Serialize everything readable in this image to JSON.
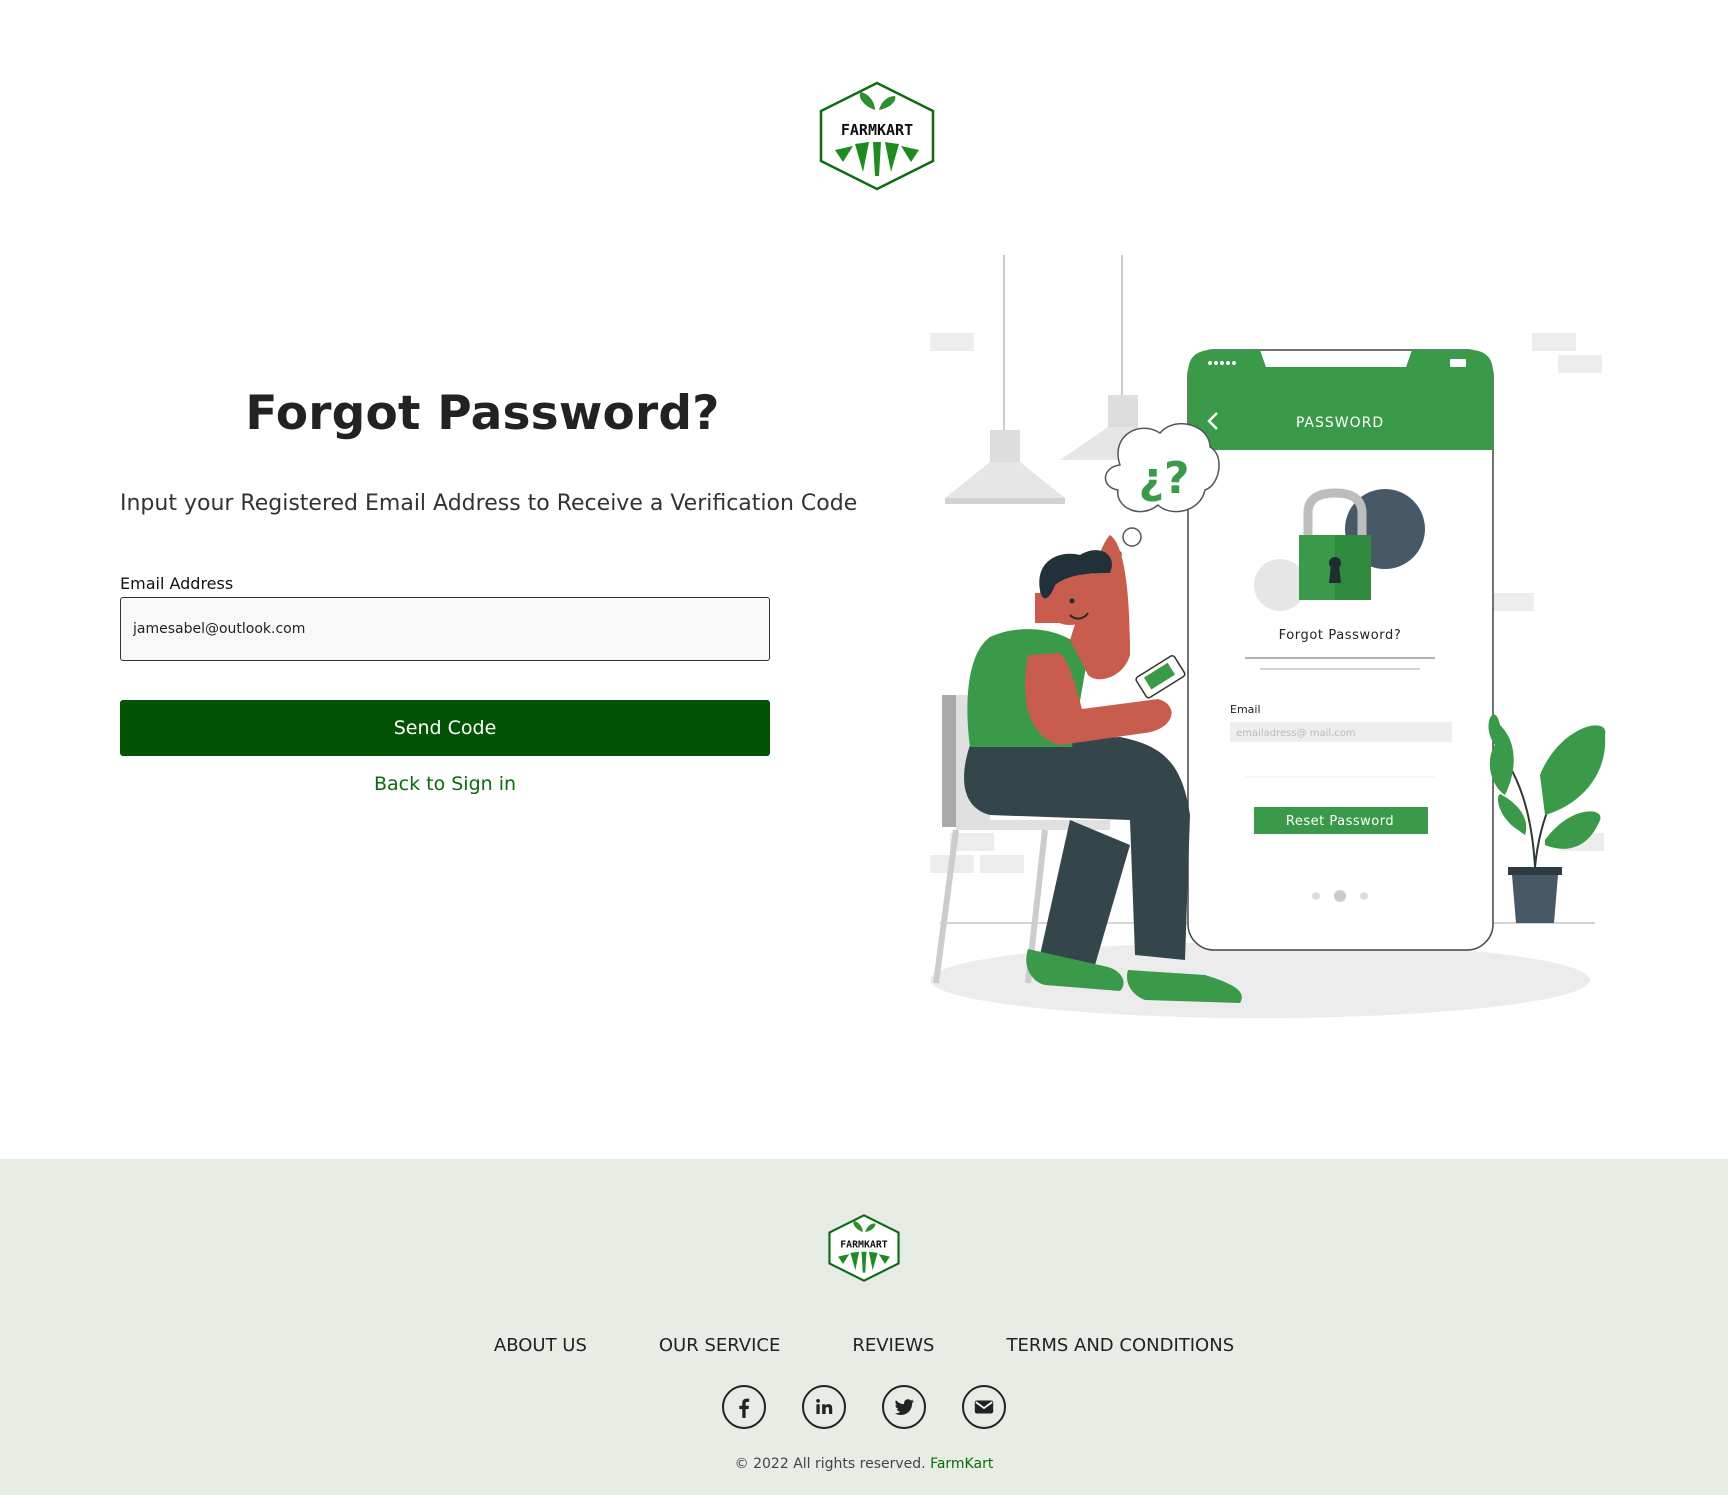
{
  "brand": {
    "logo_text": "FARMKART",
    "colors": {
      "primary": "#035304",
      "accent": "#3a9a4a",
      "footer_bg": "#e7ede4"
    }
  },
  "main": {
    "title": "Forgot Password?",
    "subtitle": "Input your Registered Email Address to Receive a Verification Code",
    "email_label": "Email Address",
    "email_value": "jamesabel@outlook.com",
    "send_button": "Send Code",
    "back_link": "Back to Sign in"
  },
  "illustration": {
    "icon": "person-with-phone-forgot-password-illustration",
    "phone_header": "PASSWORD",
    "question_marks": "¿?",
    "card_title": "Forgot Password?",
    "email_label": "Email",
    "email_placeholder": "emailadress@ mail.com",
    "button": "Reset Password"
  },
  "footer": {
    "nav": [
      "ABOUT US",
      "OUR SERVICE",
      "REVIEWS",
      "TERMS AND CONDITIONS"
    ],
    "social_icons": [
      "facebook-icon",
      "linkedin-icon",
      "twitter-icon",
      "mail-icon"
    ],
    "copyright_prefix": "© 2022 All rights reserved.",
    "copyright_brand": "FarmKart"
  }
}
